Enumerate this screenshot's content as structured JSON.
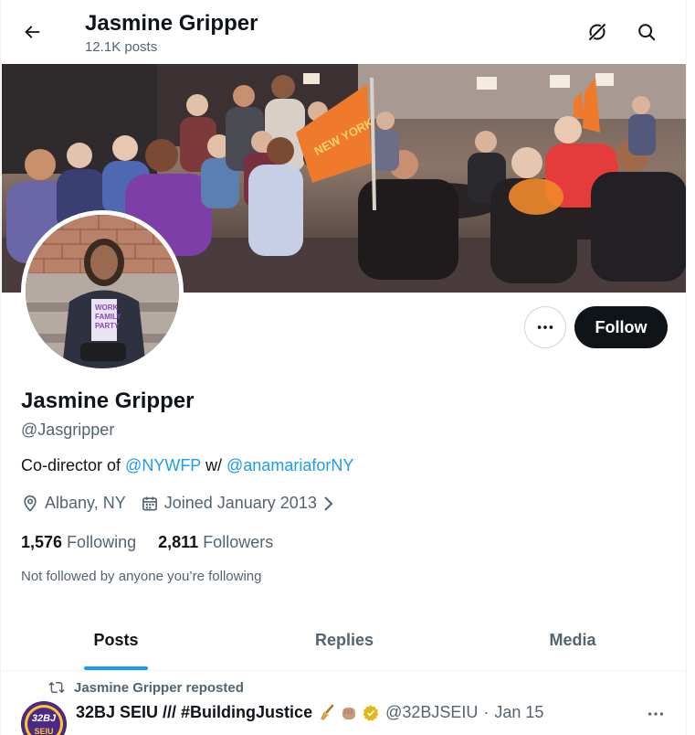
{
  "header": {
    "title": "Jasmine Gripper",
    "post_count": "12.1K posts"
  },
  "profile": {
    "name": "Jasmine Gripper",
    "handle": "@Jasgripper",
    "bio_prefix": "Co-director of ",
    "bio_link1": "@NYWFP",
    "bio_middle": " w/ ",
    "bio_link2": "@anamariaforNY",
    "location": "Albany, NY",
    "joined": "Joined January 2013",
    "following_count": "1,576",
    "following_label": "Following",
    "followers_count": "2,811",
    "followers_label": "Followers",
    "not_followed": "Not followed by anyone you’re following",
    "follow_label": "Follow"
  },
  "banner": {
    "flag_text": "NEW YORK"
  },
  "tabs": [
    {
      "label": "Posts",
      "active": true
    },
    {
      "label": "Replies",
      "active": false
    },
    {
      "label": "Media",
      "active": false
    }
  ],
  "post": {
    "repost_text": "Jasmine Gripper reposted",
    "author": "32BJ SEIU /// #BuildingJustice",
    "author_handle": "@32BJSEIU",
    "separator": "·",
    "date": "Jan 15",
    "avatar_text": "32BJ",
    "avatar_text2": "SEIU"
  },
  "colors": {
    "accent": "#1d9bf0",
    "text": "#0f1419",
    "muted": "#536471",
    "follow_bg": "#0f1419",
    "verified_gold": "#e2b719"
  },
  "icons": [
    "back-arrow-icon",
    "grok-icon",
    "search-icon",
    "more-icon",
    "location-icon",
    "calendar-icon",
    "chevron-right-icon",
    "repost-icon",
    "broom-emoji",
    "fist-emoji",
    "verified-badge-icon"
  ]
}
